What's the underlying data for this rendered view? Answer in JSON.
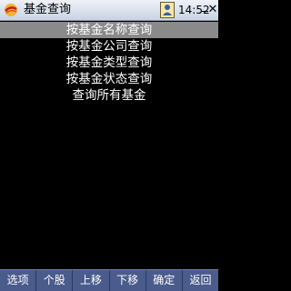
{
  "app": {
    "logo_icon": "app-logo-icon",
    "title": "基金查询"
  },
  "status": {
    "user_icon": "contact-card-icon",
    "time": "14:52",
    "minimize_icon": "minimize-icon",
    "close_icon": "close-icon",
    "close_glyph": "✕"
  },
  "menu": {
    "selected_index": 0,
    "items": [
      {
        "label": "按基金名称查询"
      },
      {
        "label": "按基金公司查询"
      },
      {
        "label": "按基金类型查询"
      },
      {
        "label": "按基金状态查询"
      },
      {
        "label": "查询所有基金"
      }
    ]
  },
  "softkeys": [
    {
      "label": "选项"
    },
    {
      "label": "个股"
    },
    {
      "label": "上移"
    },
    {
      "label": "下移"
    },
    {
      "label": "确定"
    },
    {
      "label": "返回"
    }
  ],
  "colors": {
    "background": "#000000",
    "selection": "#8a8a8a",
    "softbar": "#4a5b8c",
    "text": "#ffffff"
  }
}
